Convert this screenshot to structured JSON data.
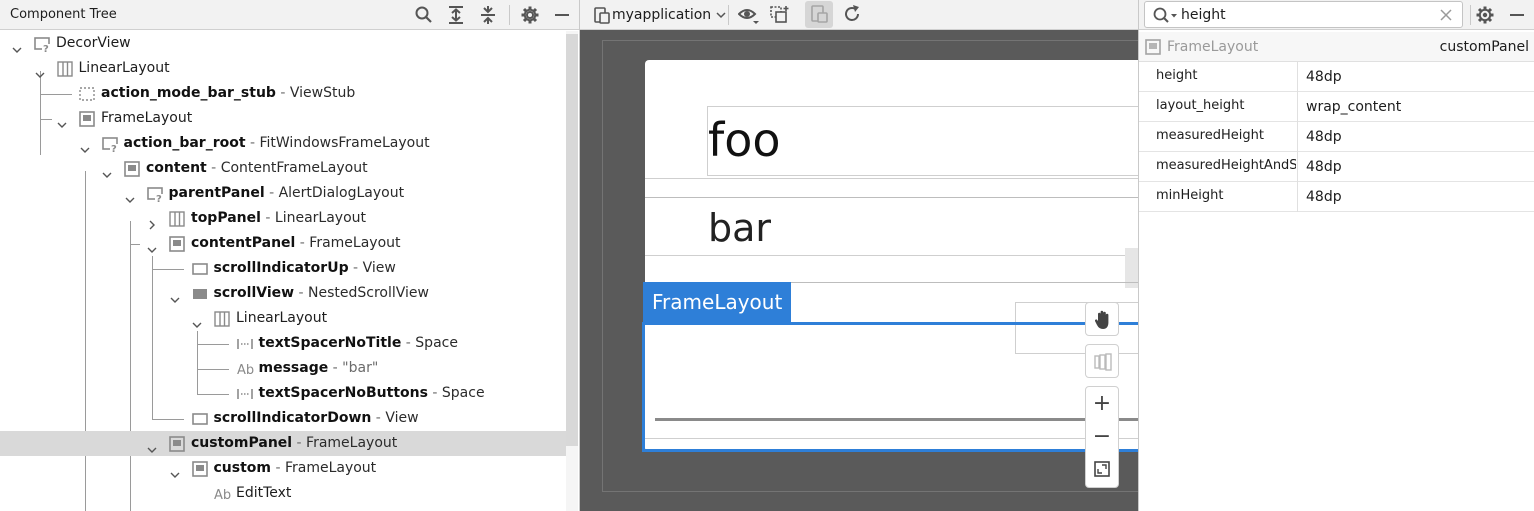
{
  "component_tree": {
    "title": "Component Tree",
    "rows": [
      {
        "name": "",
        "type": "DecorView"
      },
      {
        "name": "",
        "type": "LinearLayout"
      },
      {
        "name": "action_mode_bar_stub",
        "type": "ViewStub"
      },
      {
        "name": "",
        "type": "FrameLayout"
      },
      {
        "name": "action_bar_root",
        "type": "FitWindowsFrameLayout"
      },
      {
        "name": "content",
        "type": "ContentFrameLayout"
      },
      {
        "name": "parentPanel",
        "type": "AlertDialogLayout"
      },
      {
        "name": "topPanel",
        "type": "LinearLayout"
      },
      {
        "name": "contentPanel",
        "type": "FrameLayout"
      },
      {
        "name": "scrollIndicatorUp",
        "type": "View"
      },
      {
        "name": "scrollView",
        "type": "NestedScrollView"
      },
      {
        "name": "",
        "type": "LinearLayout"
      },
      {
        "name": "textSpacerNoTitle",
        "type": "Space"
      },
      {
        "name": "message",
        "type": "\"bar\""
      },
      {
        "name": "textSpacerNoButtons",
        "type": "Space"
      },
      {
        "name": "scrollIndicatorDown",
        "type": "View"
      },
      {
        "name": "customPanel",
        "type": "FrameLayout"
      },
      {
        "name": "custom",
        "type": "FrameLayout"
      },
      {
        "name": "",
        "type": "EditText"
      }
    ],
    "separator": " - "
  },
  "preview": {
    "device_label": "myapplication",
    "title_text": "foo",
    "message_text": "bar",
    "selected_tag": "FrameLayout",
    "zoom_in": "+",
    "zoom_out": "−"
  },
  "attributes": {
    "search_value": "height",
    "selected_type": "FrameLayout",
    "selected_id": "customPanel",
    "rows": [
      {
        "name": "height",
        "value": "48dp"
      },
      {
        "name": "layout_height",
        "value": "wrap_content"
      },
      {
        "name": "measuredHeight",
        "value": "48dp"
      },
      {
        "name": "measuredHeightAndS...",
        "value": "48dp"
      },
      {
        "name": "minHeight",
        "value": "48dp"
      }
    ]
  },
  "colors": {
    "selection_blue": "#2e7fd8",
    "tree_selected_row": "#d9d9d9",
    "canvas_background": "#5a5a5a"
  }
}
